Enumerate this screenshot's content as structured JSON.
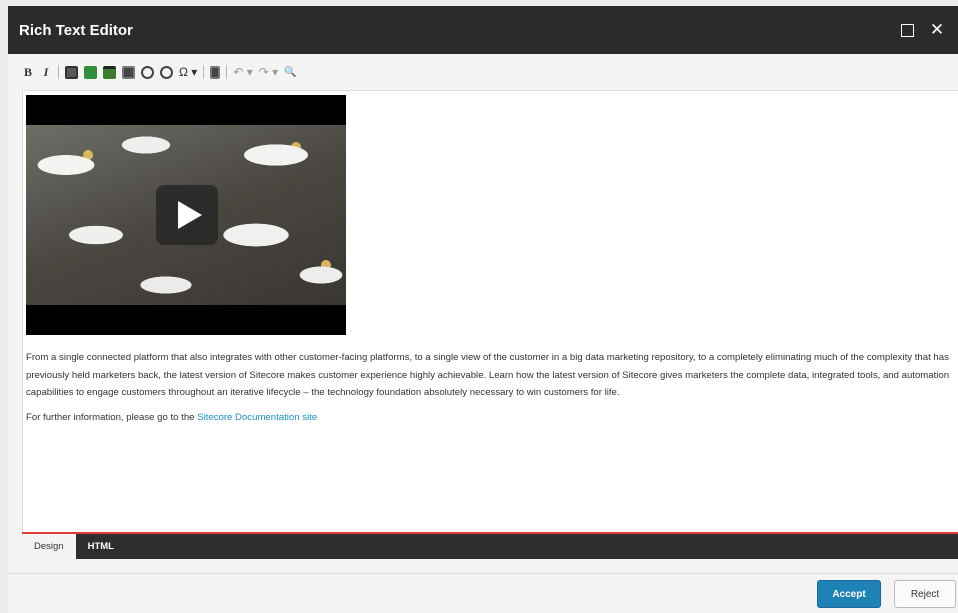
{
  "dialog": {
    "title": "Rich Text Editor",
    "maximize_icon": "maximize-icon",
    "close_icon": "close-icon",
    "close_glyph": "✕"
  },
  "toolbar": {
    "bold": "B",
    "italic": "I",
    "special_char": "Ω ▾",
    "undo": "↶ ▾",
    "redo": "↷ ▾",
    "find": "🔍"
  },
  "editor": {
    "paragraph1": "From a single connected platform that also integrates with other customer-facing platforms, to a single view of the customer in a big data marketing repository, to a completely eliminating much of the complexity that has previously held marketers back, the latest version of Sitecore makes customer experience highly achievable. Learn how the latest version of Sitecore gives marketers the complete data, integrated tools, and automation capabilities to engage customers throughout an iterative lifecycle – the technology foundation absolutely necessary to win customers for life.",
    "paragraph2_prefix": "For further information, please go to the ",
    "paragraph2_link": "Sitecore Documentation site"
  },
  "tabs": {
    "design": "Design",
    "html": "HTML"
  },
  "footer": {
    "accept": "Accept",
    "reject": "Reject"
  },
  "colors": {
    "titlebar": "#2b2b2b",
    "accent": "#1e82b6",
    "tab_underline": "#e13b32",
    "link": "#1a8fc8"
  }
}
